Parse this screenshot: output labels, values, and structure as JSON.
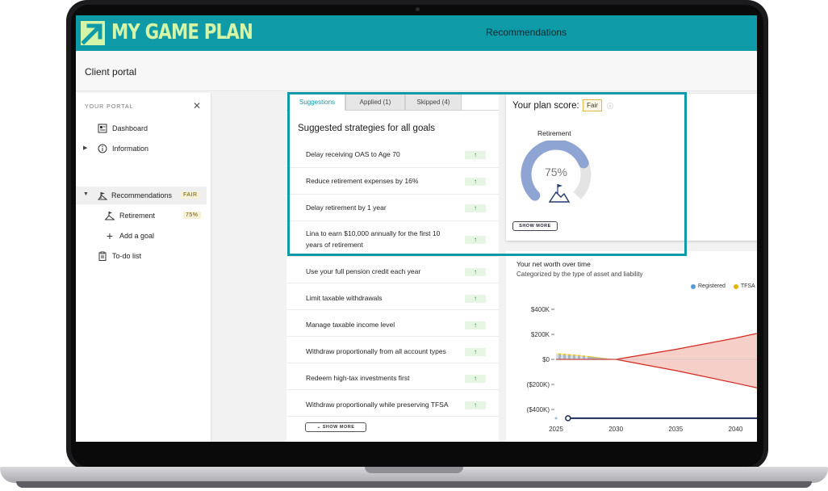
{
  "app": {
    "brand": "MY GAME PLAN",
    "page_title": "Recommendations",
    "portal_title": "Client portal",
    "colors": {
      "brand_teal": "#0e9aa7",
      "brand_lime": "#d4f5a8",
      "positive_green": "#1f8a2e",
      "liability_red": "#d2281e",
      "registered_blue": "#5b9bd5",
      "tfsa_gold": "#e3b400"
    }
  },
  "sidebar": {
    "heading": "YOUR PORTAL",
    "close_icon": "close-icon",
    "items": [
      {
        "label": "Dashboard",
        "icon": "dashboard-icon"
      },
      {
        "label": "Information",
        "icon": "info-icon"
      },
      {
        "label": "Recommendations",
        "icon": "flag-icon",
        "badge": "FAIR"
      },
      {
        "label": "Retirement",
        "icon": "goal-flag-icon",
        "badge": "75%"
      },
      {
        "label": "Add a goal",
        "icon": "plus-icon"
      },
      {
        "label": "To-do list",
        "icon": "clipboard-icon"
      }
    ]
  },
  "tabs": [
    {
      "label": "Suggestions",
      "active": true
    },
    {
      "label": "Applied (1)",
      "active": false
    },
    {
      "label": "Skipped (4)",
      "active": false
    }
  ],
  "suggestions": {
    "title": "Suggested strategies for all goals",
    "items": [
      "Delay receiving OAS to Age 70",
      "Reduce retirement expenses by 16%",
      "Delay retirement by 1 year",
      "Lina to earn $10,000 annually for the first 10 years of retirement",
      "Use your full pension credit each year",
      "Limit taxable withdrawals",
      "Manage taxable income level",
      "Withdraw proportionally from all account types",
      "Redeem high-tax investments first",
      "Withdraw proportionally while preserving TFSA"
    ],
    "indicator": "↑",
    "show_more": "SHOW MORE"
  },
  "score": {
    "title": "Your plan score:",
    "badge": "Fair",
    "goal_label": "Retirement",
    "percent_label": "75%",
    "percent_value": 75,
    "show_more": "SHOW MORE"
  },
  "chart_data": {
    "type": "area",
    "title": "Your net worth over time",
    "subtitle": "Categorized by the type of asset and liability",
    "legend": [
      "Registered",
      "TFSA"
    ],
    "y_tick_labels": [
      "$400K",
      "$200K",
      "$0",
      "($200K)",
      "($400K)"
    ],
    "y_ticks": [
      400000,
      200000,
      0,
      -200000,
      -400000
    ],
    "x_tick_labels": [
      "2025",
      "2030",
      "2035",
      "2040"
    ],
    "x_ticks": [
      2025,
      2030,
      2035,
      2040
    ],
    "xlim": [
      2025,
      2042.4
    ],
    "ylim": [
      -400000,
      400000
    ],
    "series": [
      {
        "name": "Registered",
        "x": [
          2025,
          2027,
          2030
        ],
        "y": [
          40000,
          25000,
          0
        ]
      },
      {
        "name": "TFSA",
        "x": [
          2025,
          2027,
          2030
        ],
        "y": [
          50000,
          35000,
          0
        ]
      }
    ],
    "upper_red": {
      "x": [
        2025,
        2030,
        2035,
        2040,
        2042.4
      ],
      "y": [
        0,
        0,
        80000,
        170000,
        220000
      ]
    },
    "lower_red": {
      "x": [
        2025,
        2030,
        2035,
        2040,
        2042.4
      ],
      "y": [
        0,
        0,
        -90000,
        -190000,
        -240000
      ]
    },
    "navy_line": {
      "x": [
        2026,
        2042.4
      ],
      "y": [
        -470000,
        -470000
      ]
    },
    "navy_start_dot": {
      "x": 2026,
      "y": -470000
    }
  }
}
